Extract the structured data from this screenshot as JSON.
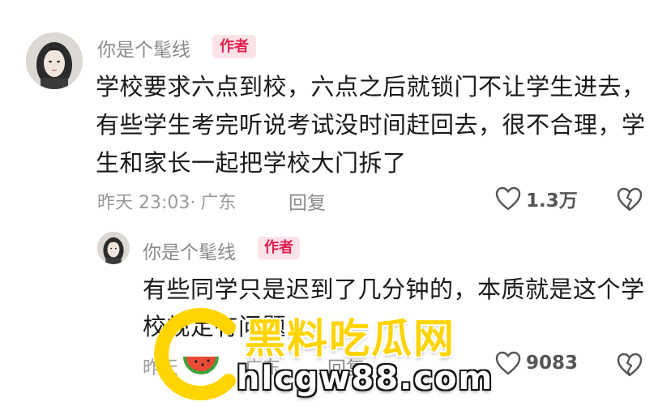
{
  "comments": [
    {
      "username": "你是个髦线",
      "badge": "作者",
      "content": "学校要求六点到校，六点之后就锁门不让学生进去，有些学生考完听说考试没时间赶回去，很不合理，学生和家长一起把学校大门拆了",
      "time": "昨天 23:03",
      "location": "广东",
      "reply_label": "回复",
      "likes": "1.3万"
    },
    {
      "username": "你是个髦线",
      "badge": "作者",
      "content": "有些同学只是迟到了几分钟的，本质就是这个学校规定有问题",
      "time": "昨天",
      "location": "广东",
      "reply_label": "回复",
      "likes": "9083"
    }
  ],
  "watermark": {
    "title": "黑料吃瓜网",
    "url": "hlcgw88.com"
  },
  "colors": {
    "badge_text": "#e4204f",
    "badge_bg": "#fbe3e8",
    "watermark_yellow": "#ffd400"
  }
}
